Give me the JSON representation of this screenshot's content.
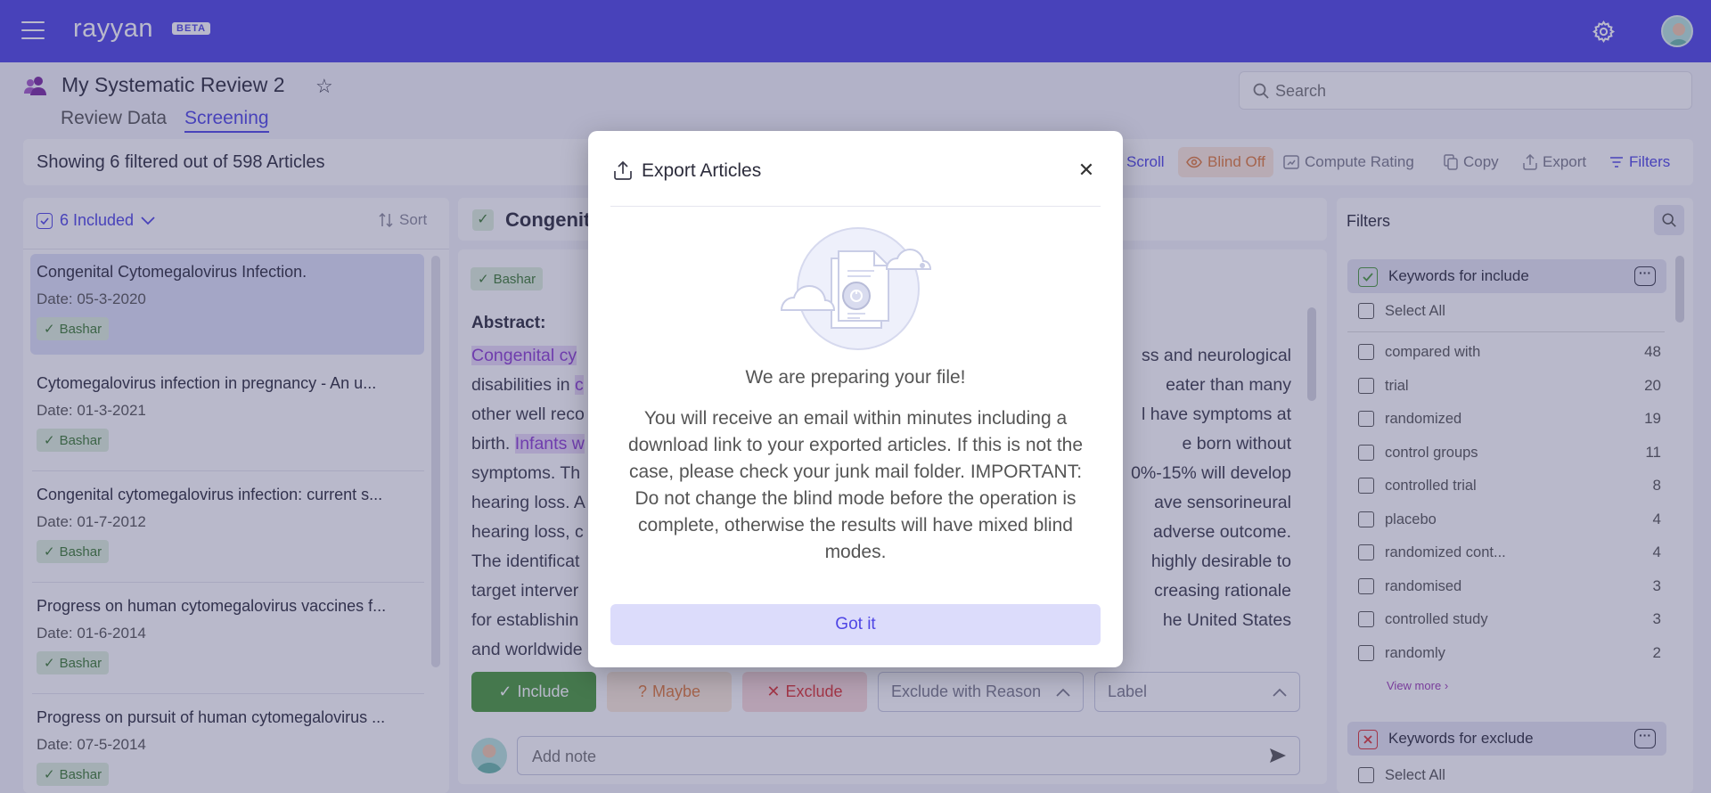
{
  "app": {
    "logo": "rayyan",
    "badge": "BETA"
  },
  "project": {
    "title": "My Systematic Review 2",
    "tabs": [
      {
        "label": "Review Data"
      },
      {
        "label": "Screening"
      }
    ]
  },
  "search": {
    "placeholder": "Search"
  },
  "toolbar": {
    "showing": "Showing 6 filtered out of 598 Articles",
    "scroll": "Scroll",
    "blind": "Blind Off",
    "compute": "Compute Rating",
    "copy": "Copy",
    "export": "Export",
    "filters": "Filters"
  },
  "list": {
    "included_label": "6  Included",
    "sort_label": "Sort",
    "articles": [
      {
        "title": "Congenital Cytomegalovirus Infection.",
        "date": "Date: 05-3-2020",
        "tag": "Bashar"
      },
      {
        "title": "Cytomegalovirus infection in pregnancy - An u...",
        "date": "Date: 01-3-2021",
        "tag": "Bashar"
      },
      {
        "title": "Congenital cytomegalovirus infection: current s...",
        "date": "Date: 01-7-2012",
        "tag": "Bashar"
      },
      {
        "title": "Progress on human cytomegalovirus vaccines f...",
        "date": "Date: 01-6-2014",
        "tag": "Bashar"
      },
      {
        "title": "Progress on pursuit of human cytomegalovirus ...",
        "date": "Date: 07-5-2014",
        "tag": "Bashar"
      }
    ]
  },
  "article": {
    "title": "Congenit",
    "tag": "Bashar",
    "abstract_label": "Abstract:",
    "lines": [
      {
        "hl": "Congenital cy",
        "rest_left": "",
        "rest_right": "ss and neurological"
      },
      {
        "hl": "",
        "rest_left": "disabilities in ",
        "hl2": "c",
        "rest_right": "eater than many"
      },
      {
        "hl": "",
        "rest_left": "other well reco",
        "rest_right": "l have symptoms at"
      },
      {
        "hl": "",
        "rest_left": "birth. ",
        "hl2": "Infants w",
        "rest_right": "e born without"
      },
      {
        "hl": "",
        "rest_left": "symptoms. Th",
        "rest_right": "0%-15% will develop"
      },
      {
        "hl": "",
        "rest_left": "hearing loss. A",
        "rest_right": "ave sensorineural"
      },
      {
        "hl": "",
        "rest_left": "hearing loss, c",
        "rest_right": "adverse outcome."
      },
      {
        "hl": "",
        "rest_left": "The identificat",
        "rest_right": "highly desirable to"
      },
      {
        "hl": "",
        "rest_left": "target interver",
        "rest_right": "creasing rationale"
      },
      {
        "hl": "",
        "rest_left": "for establishin",
        "rest_right": "he United States"
      },
      {
        "hl": "",
        "rest_left": "and worldwide",
        "rest_right": ""
      }
    ]
  },
  "decisions": {
    "include": "Include",
    "maybe": "Maybe",
    "exclude": "Exclude",
    "reason": "Exclude with Reason",
    "label": "Label"
  },
  "note": {
    "placeholder": "Add note"
  },
  "filters": {
    "title": "Filters",
    "include_group": "Keywords for include",
    "exclude_group": "Keywords for exclude",
    "select_all": "Select All",
    "view_more": "View more",
    "keywords": [
      {
        "label": "compared with",
        "count": "48"
      },
      {
        "label": "trial",
        "count": "20"
      },
      {
        "label": "randomized",
        "count": "19"
      },
      {
        "label": "control groups",
        "count": "11"
      },
      {
        "label": "controlled trial",
        "count": "8"
      },
      {
        "label": "placebo",
        "count": "4"
      },
      {
        "label": "randomized cont...",
        "count": "4"
      },
      {
        "label": "randomised",
        "count": "3"
      },
      {
        "label": "controlled study",
        "count": "3"
      },
      {
        "label": "randomly",
        "count": "2"
      }
    ]
  },
  "modal": {
    "title": "Export Articles",
    "heading": "We are preparing your file!",
    "body": "You will receive an email within minutes including a download link to your exported articles. If this is not the case, please check your junk mail folder. IMPORTANT: Do not change the blind mode before the operation is complete, otherwise the results will have mixed blind modes.",
    "button": "Got it"
  },
  "colors": {
    "brand": "#4f46e5",
    "include": "#4a9a3a",
    "maybe": "#e07a3a",
    "exclude": "#dd3333",
    "highlight": "#8c3dd1"
  },
  "icons": [
    "menu-icon",
    "gear-icon",
    "user-avatar-icon",
    "users-icon",
    "star-icon",
    "search-icon",
    "eye-icon",
    "compute-icon",
    "copy-icon",
    "export-icon",
    "filter-icon",
    "checkbox-icon",
    "chevron-down-icon",
    "sort-icon",
    "check-icon",
    "question-icon",
    "close-icon",
    "chevron-up-icon",
    "send-icon",
    "more-icon",
    "chevron-right-icon",
    "upload-icon"
  ]
}
